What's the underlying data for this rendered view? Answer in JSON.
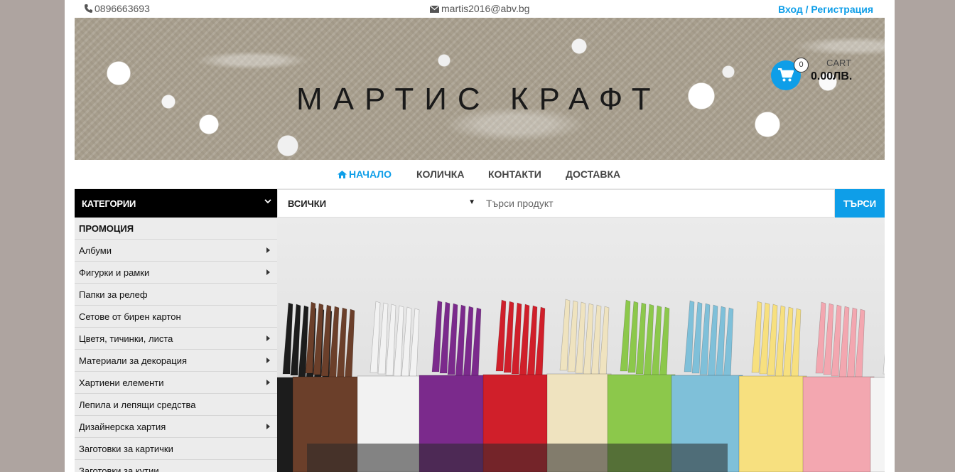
{
  "topbar": {
    "phone": "0896663693",
    "email": "martis2016@abv.bg",
    "login": "Вход / Регистрация"
  },
  "banner": {
    "site_title": "МАРТИС КРАФТ",
    "cart_count": "0",
    "cart_label": "CART",
    "cart_total": "0.00ЛВ."
  },
  "nav": {
    "items": [
      "НАЧАЛО",
      "КОЛИЧКА",
      "КОНТАКТИ",
      "ДОСТАВКА"
    ]
  },
  "search": {
    "categories_label": "КАТЕГОРИИ",
    "select_value": "ВСИЧКИ",
    "placeholder": "Търси продукт",
    "button": "ТЪРСИ"
  },
  "categories": [
    {
      "label": "ПРОМОЦИЯ",
      "submenu": false
    },
    {
      "label": "Албуми",
      "submenu": true
    },
    {
      "label": "Фигурки и рамки",
      "submenu": true
    },
    {
      "label": "Папки за релеф",
      "submenu": false
    },
    {
      "label": "Сетове от бирен картон",
      "submenu": false
    },
    {
      "label": "Цветя, тичинки, листа",
      "submenu": true
    },
    {
      "label": "Материали за декорация",
      "submenu": true
    },
    {
      "label": "Хартиени елементи",
      "submenu": true
    },
    {
      "label": "Лепила и лепящи средства",
      "submenu": false
    },
    {
      "label": "Дизайнерска хартия",
      "submenu": true
    },
    {
      "label": "Заготовки за картички",
      "submenu": false
    },
    {
      "label": "Заготовки за кутии",
      "submenu": false
    }
  ],
  "colors": {
    "accent": "#0e9ee8",
    "page_bg": "#aea4a0",
    "category_header": "#000000"
  },
  "hero": {
    "album_colors": [
      "#1c1c1c",
      "#6b3f2a",
      "#f2f2f2",
      "#7b2a8c",
      "#d01f2a",
      "#efe3bf",
      "#8cc84b",
      "#7fc0d9",
      "#f7e07f",
      "#f3a7b0",
      "#f4f4f4"
    ]
  }
}
